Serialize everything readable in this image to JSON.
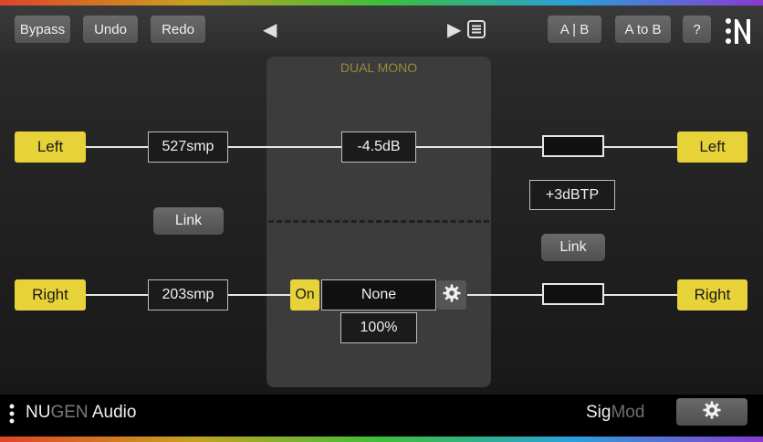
{
  "toolbar": {
    "bypass": "Bypass",
    "undo": "Undo",
    "redo": "Redo",
    "prev_icon": "◀",
    "next_icon": "▶",
    "ab": "A | B",
    "a_to_b": "A to B",
    "help": "?"
  },
  "panel": {
    "title": "DUAL MONO"
  },
  "left_channel": {
    "input_label": "Left",
    "delay": "527smp",
    "gain": "-4.5dB",
    "output_label": "Left"
  },
  "right_channel": {
    "input_label": "Right",
    "delay": "203smp",
    "on": "On",
    "filter": "None",
    "mix": "100%",
    "output_label": "Right"
  },
  "delay_link": "Link",
  "limiter": {
    "ceiling": "+3dBTP",
    "link": "Link"
  },
  "footer": {
    "brand_nu": "NU",
    "brand_gen": "GEN",
    "brand_audio": " Audio",
    "product_sig": "Sig",
    "product_mod": "Mod"
  },
  "colors": {
    "accent_yellow": "#e8d23a",
    "panel_title": "#9a8a3a"
  }
}
